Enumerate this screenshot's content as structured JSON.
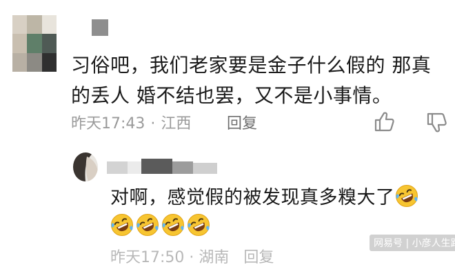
{
  "comment": {
    "text": "习俗吧，我们老家要是金子什么假的 那真的丢人 婚不结也罢，又不是小事情。",
    "time": "昨天17:43",
    "separator": "·",
    "location": "江西",
    "reply_label": "回复",
    "like_icon": "thumbs-up-icon",
    "dislike_icon": "thumbs-down-icon"
  },
  "reply": {
    "text": "对啊，感觉假的被发现真多糗大了",
    "emoji_icon": "rolling-laughing-emoji",
    "emoji_count_inline": 1,
    "emoji_count_line2": 4,
    "time_partial": "昨天17:50",
    "location_partial": "湖南",
    "reply_label_partial": "回复"
  },
  "watermark": {
    "text": "网易号 | 小彦人生路"
  },
  "colors": {
    "text_primary": "#1a1a1a",
    "text_meta": "#9a9a9a",
    "emoji_yellow": "#f7c531",
    "mosaic_a": "#cfc7b8",
    "mosaic_b": "#6f6f6f",
    "mosaic_c": "#5e7f6b"
  }
}
